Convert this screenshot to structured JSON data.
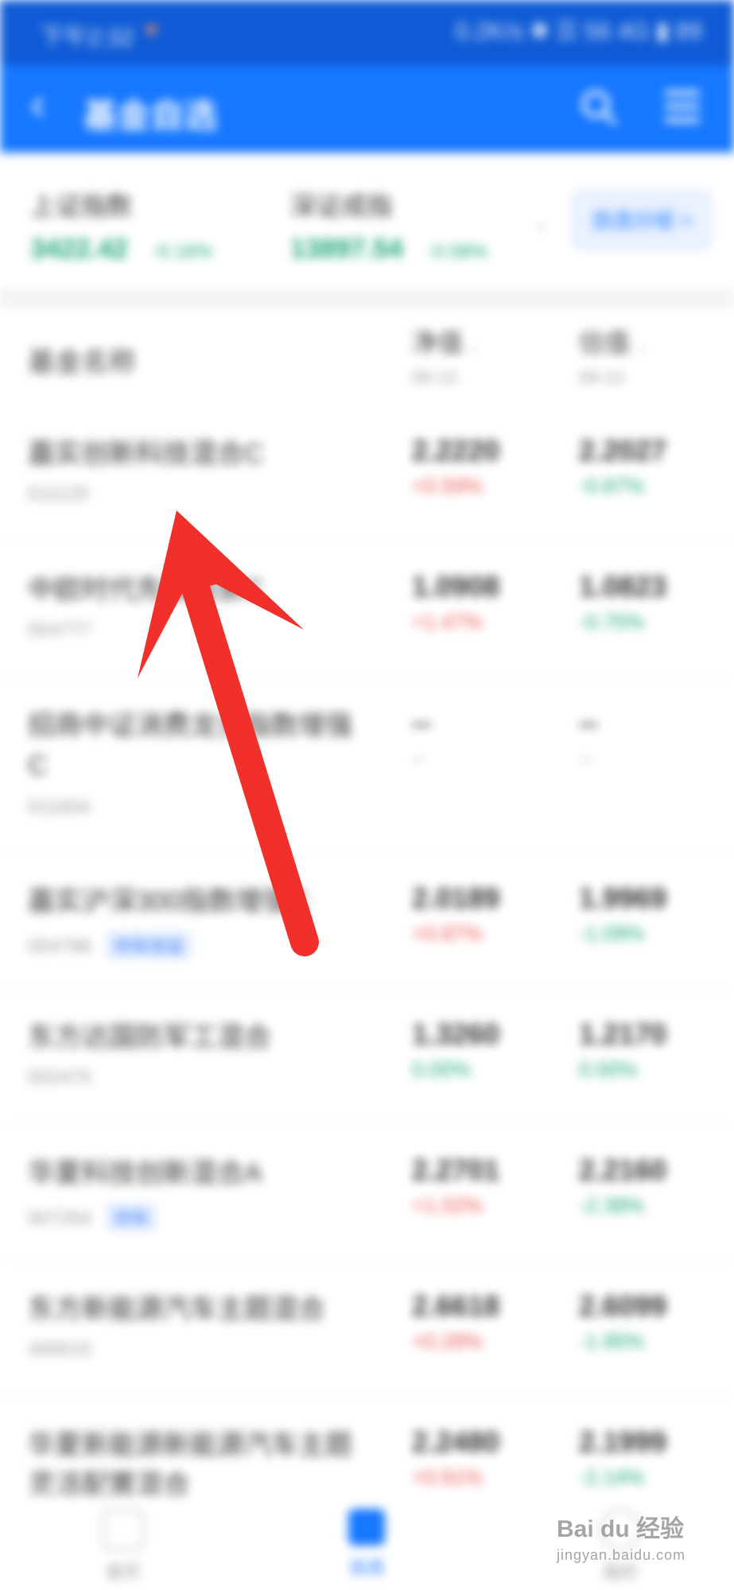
{
  "status": {
    "time": "下午2:32",
    "right": "0.2K/s ✱ ☰ 56 4G ▮ 89"
  },
  "header": {
    "back": "‹",
    "title": "基金自选"
  },
  "indices": [
    {
      "name": "上证指数",
      "value": "3422.42",
      "change": "-0.16%"
    },
    {
      "name": "深证成指",
      "value": "13897.54",
      "change": "-0.58%"
    }
  ],
  "mine_button": "自选分组 >",
  "table_header": {
    "name": "基金名称",
    "col1": {
      "label": "净值",
      "date": "09-13"
    },
    "col2": {
      "label": "估值",
      "date": "09-13"
    }
  },
  "rows": [
    {
      "name": "嘉实创新科技混合C",
      "code": "011120",
      "tag": "",
      "nav": "2.2220",
      "nav_chg": "+0.59%",
      "est": "2.2027",
      "est_chg": "-0.87%"
    },
    {
      "name": "中欧时代先锋股票C",
      "code": "004777",
      "tag": "",
      "nav": "1.0908",
      "nav_chg": "+1.47%",
      "est": "1.0823",
      "est_chg": "-0.75%"
    },
    {
      "name": "招商中证消费龙头指数增强C",
      "code": "011604",
      "tag": "",
      "nav": "--",
      "nav_chg": "--",
      "est": "--",
      "est_chg": "--"
    },
    {
      "name": "嘉实沪深300指数增强C",
      "code": "004788",
      "tag": "持有收益",
      "nav": "2.0189",
      "nav_chg": "+0.87%",
      "est": "1.9969",
      "est_chg": "-1.09%"
    },
    {
      "name": "东方达国防军工混合",
      "code": "002475",
      "tag": "",
      "nav": "1.3260",
      "nav_chg": "0.00%",
      "est": "1.2170",
      "est_chg": "0.00%"
    },
    {
      "name": "华夏科技创新混合A",
      "code": "007264",
      "tag": "持有",
      "nav": "2.2701",
      "nav_chg": "+1.02%",
      "est": "2.2160",
      "est_chg": "-2.38%"
    },
    {
      "name": "东方新能源汽车主题混合",
      "code": "400015",
      "tag": "",
      "nav": "2.6618",
      "nav_chg": "+0.28%",
      "est": "2.6099",
      "est_chg": "-1.95%"
    },
    {
      "name": "华夏新能源新能源汽车主题灵活配置混合",
      "code": "",
      "tag": "",
      "nav": "2.2480",
      "nav_chg": "+0.91%",
      "est": "2.1999",
      "est_chg": "-2.14%"
    }
  ],
  "tabs": [
    {
      "label": "首页"
    },
    {
      "label": "自选"
    },
    {
      "label": "我的"
    }
  ],
  "colors": {
    "brand": "#1677ff",
    "up": "#e8534a",
    "down": "#1aa37a",
    "arrow": "#f2302b"
  },
  "watermark": {
    "brand": "Bai du 经验",
    "url": "jingyan.baidu.com"
  }
}
